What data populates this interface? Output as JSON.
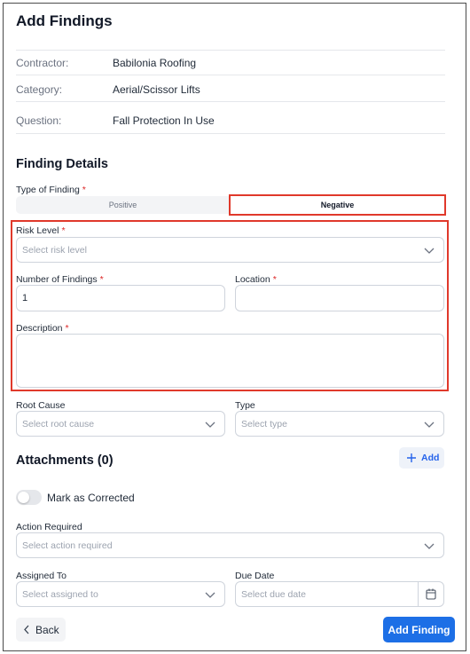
{
  "header": {
    "title": "Add Findings"
  },
  "info": [
    {
      "label": "Contractor:",
      "value": "Babilonia Roofing"
    },
    {
      "label": "Category:",
      "value": "Aerial/Scissor Lifts"
    },
    {
      "label": "Question:",
      "value": "Fall Protection In Use"
    }
  ],
  "finding_details": {
    "title": "Finding Details",
    "type_label": "Type of Finding",
    "required_mark": "*",
    "options": [
      "Positive",
      "Negative"
    ],
    "selected": "Negative"
  },
  "fields": {
    "risk_level": {
      "label": "Risk Level",
      "placeholder": "Select risk level"
    },
    "number_of_findings": {
      "label": "Number of Findings",
      "value": "1"
    },
    "location": {
      "label": "Location",
      "value": ""
    },
    "description": {
      "label": "Description",
      "value": ""
    },
    "root_cause": {
      "label": "Root Cause",
      "placeholder": "Select root cause"
    },
    "type": {
      "label": "Type",
      "placeholder": "Select type"
    },
    "action_required": {
      "label": "Action Required",
      "placeholder": "Select action required"
    },
    "assigned_to": {
      "label": "Assigned To",
      "placeholder": "Select assigned to"
    },
    "due_date": {
      "label": "Due Date",
      "placeholder": "Select due date"
    }
  },
  "attachments": {
    "title": "Attachments (0)",
    "add_label": "Add"
  },
  "mark_corrected": {
    "label": "Mark as Corrected",
    "on": false
  },
  "footer": {
    "back_label": "Back",
    "submit_label": "Add Finding"
  },
  "colors": {
    "primary": "#1d6fe6",
    "highlight": "#e0392b",
    "required": "#dc2626"
  },
  "icons": [
    "chevron-down-icon",
    "plus-icon",
    "calendar-icon",
    "chevron-left-icon"
  ]
}
